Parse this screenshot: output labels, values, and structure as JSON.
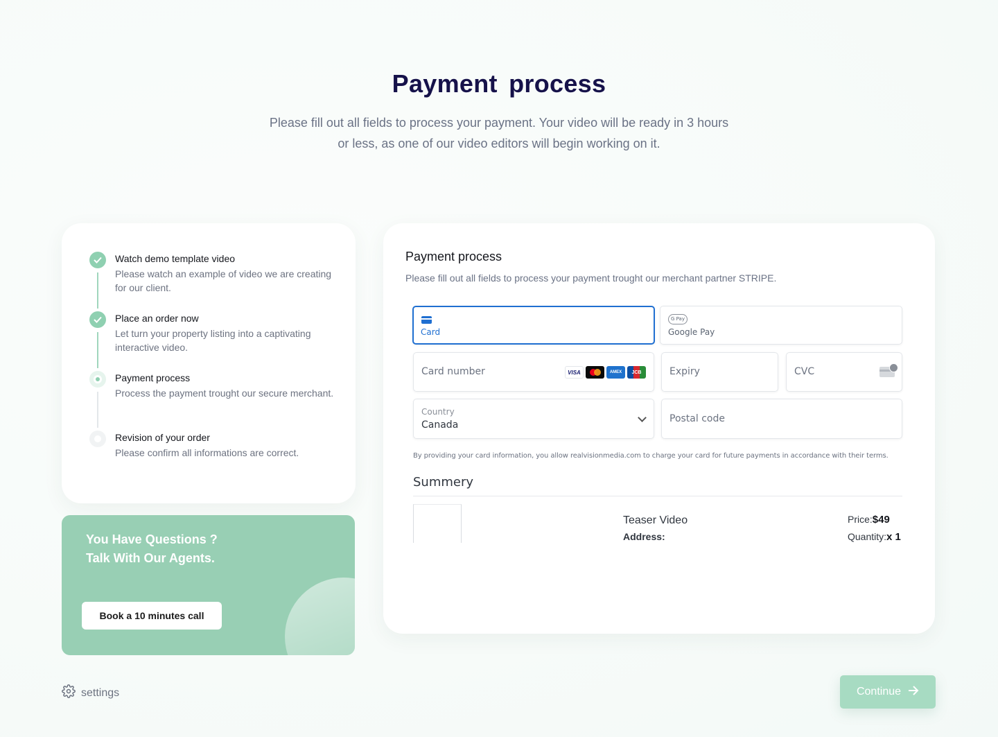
{
  "hero": {
    "title": "Payment  process",
    "subtitle": "Please fill out all fields to process your payment. Your video will be ready in 3 hours or less, as one of our video editors will begin working on it."
  },
  "steps": [
    {
      "title": "Watch demo template video",
      "desc": "Please watch an example of video we are creating for our client.",
      "status": "done"
    },
    {
      "title": "Place an order now",
      "desc": "Let turn your property listing into a captivating interactive video.",
      "status": "done"
    },
    {
      "title": "Payment process",
      "desc": "Process the payment trought our secure merchant.",
      "status": "current"
    },
    {
      "title": "Revision of your order",
      "desc": "Please confirm all informations are correct.",
      "status": "pending"
    }
  ],
  "help": {
    "title_line1": "You Have Questions ?",
    "title_line2": "Talk With Our Agents.",
    "button": "Book a 10 minutes call"
  },
  "payment": {
    "title": "Payment process",
    "subtitle": "Please fill out all fields to process your payment trought our merchant partner STRIPE.",
    "methods": [
      {
        "label": "Card",
        "icon": "credit-card-icon",
        "selected": true
      },
      {
        "label": "Google Pay",
        "icon": "google-pay-icon",
        "selected": false
      }
    ],
    "card_number_placeholder": "Card number",
    "expiry_placeholder": "Expiry",
    "cvc_placeholder": "CVC",
    "country_label": "Country",
    "country_value": "Canada",
    "postal_placeholder": "Postal code",
    "brands": [
      "VISA",
      "",
      "AMEX",
      "JCB"
    ],
    "terms": "By providing your card information, you allow realvisionmedia.com to charge your card for future payments in accordance with their terms."
  },
  "summary": {
    "title": "Summery",
    "item_name": "Teaser Video",
    "address_label": "Address:",
    "price_label": "Price:",
    "price_value": "$49",
    "quantity_label": "Quantity:",
    "quantity_value": "x 1"
  },
  "footer": {
    "settings_label": "settings",
    "continue_label": "Continue"
  },
  "colors": {
    "accent_green": "#98cfb4",
    "primary_blue": "#1f6fd1",
    "title_navy": "#16124a"
  }
}
